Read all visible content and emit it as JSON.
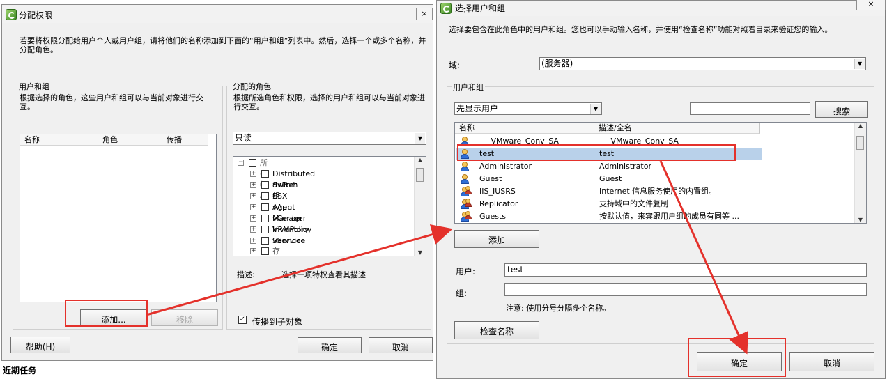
{
  "left_dialog": {
    "title": "分配权限",
    "close_label": "×",
    "instructions": "若要将权限分配给用户个人或用户组，请将他们的名称添加到下面的“用户和组”列表中。然后，选择一个或多个名称，并分配角色。",
    "users_group": {
      "legend": "用户和组",
      "desc": "根据选择的角色，这些用户和组可以与当前对象进行交互。",
      "columns": [
        "名称",
        "角色",
        "传播"
      ],
      "add_label": "添加...",
      "remove_label": "移除"
    },
    "roles_group": {
      "legend": "分配的角色",
      "desc": "根据所选角色和权限，选择的用户和组可以与当前对象进行交互。",
      "role_select": "只读",
      "tree_root": "所有特权",
      "tree_items": [
        "Distributed Switch",
        "dvPort 组",
        "ESX Agent Manager",
        "vApp",
        "vCenter Inventory Service",
        "VRMPolicy",
        "vService",
        "存储视图"
      ],
      "desc_label": "描述:",
      "desc_value": "选择一项特权查看其描述",
      "propagate_label": "传播到子对象",
      "propagate_checked": true
    },
    "help_label": "帮助(H)",
    "ok_label": "确定",
    "cancel_label": "取消"
  },
  "recent_tasks": "近期任务",
  "right_dialog": {
    "title": "选择用户和组",
    "instructions": "选择要包含在此角色中的用户和组。您也可以手动输入名称，并使用“检查名称”功能对照着目录来验证您的输入。",
    "domain_label": "域:",
    "domain_value": "(服务器)",
    "users_group": {
      "legend": "用户和组",
      "filter_value": "先显示用户",
      "search_value": "",
      "search_label": "搜索",
      "columns": [
        "名称",
        "描述/全名"
      ],
      "rows": [
        {
          "name": "___VMware_Conv_SA___",
          "desc": "___VMware_Conv_SA___",
          "icon": "user-icon",
          "selected": false
        },
        {
          "name": "test",
          "desc": "test",
          "icon": "user-icon",
          "selected": true
        },
        {
          "name": "Administrator",
          "desc": "Administrator",
          "icon": "user-icon",
          "selected": false
        },
        {
          "name": "Guest",
          "desc": "Guest",
          "icon": "user-icon",
          "selected": false
        },
        {
          "name": "IIS_IUSRS",
          "desc": "Internet 信息服务使用的内置组。",
          "icon": "group-icon",
          "selected": false
        },
        {
          "name": "Replicator",
          "desc": "支持域中的文件复制",
          "icon": "group-icon",
          "selected": false
        },
        {
          "name": "Guests",
          "desc": "按默认值，来宾跟用户组的成员有同等 ...",
          "icon": "group-icon",
          "selected": false
        }
      ],
      "add_label": "添加"
    },
    "user_label": "用户:",
    "user_value": "test",
    "group_label": "组:",
    "group_value": "",
    "note": "注意: 使用分号分隔多个名称。",
    "check_label": "检查名称",
    "ok_label": "确定",
    "cancel_label": "取消"
  },
  "colors": {
    "annotation": "#e4312b",
    "selection": "#b9d1ea"
  }
}
